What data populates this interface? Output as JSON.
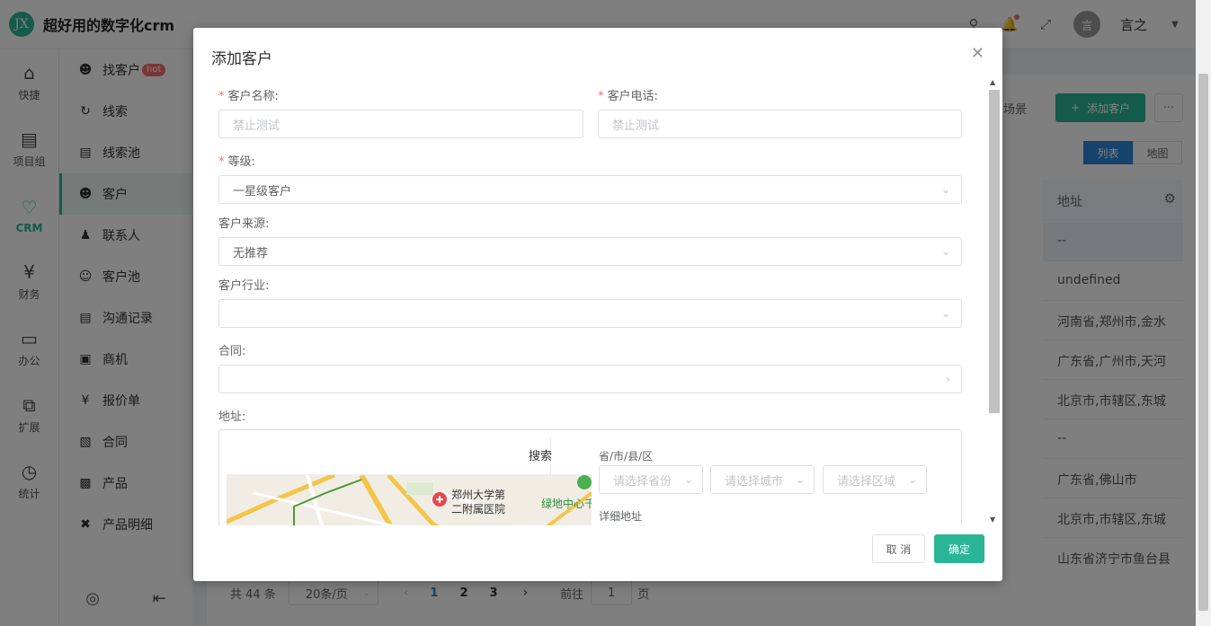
{
  "header": {
    "logo_text": "JX",
    "app_title": "超好用的数字化crm",
    "avatar_char": "言",
    "user_name": "言之"
  },
  "rail": [
    {
      "label": "快捷",
      "icon": "home-icon"
    },
    {
      "label": "项目组",
      "icon": "document-icon"
    },
    {
      "label": "CRM",
      "icon": "crm-heart-icon",
      "active": true
    },
    {
      "label": "财务",
      "icon": "finance-icon"
    },
    {
      "label": "办公",
      "icon": "monitor-icon"
    },
    {
      "label": "扩展",
      "icon": "extend-icon"
    },
    {
      "label": "统计",
      "icon": "chart-icon"
    }
  ],
  "submenu": [
    {
      "label": "找客户",
      "badge": "hot"
    },
    {
      "label": "线索"
    },
    {
      "label": "线索池"
    },
    {
      "label": "客户",
      "active": true
    },
    {
      "label": "联系人"
    },
    {
      "label": "客户池"
    },
    {
      "label": "沟通记录"
    },
    {
      "label": "商机"
    },
    {
      "label": "报价单"
    },
    {
      "label": "合同"
    },
    {
      "label": "产品"
    },
    {
      "label": "产品明细"
    }
  ],
  "toolbar": {
    "scene_label": "场景",
    "add_customer": "添加客户",
    "more": "···",
    "view_list": "列表",
    "view_map": "地图"
  },
  "table": {
    "address_header": "地址",
    "addresses": [
      "--",
      "undefined",
      "河南省,郑州市,金水",
      "广东省,广州市,天河",
      "北京市,市辖区,东城",
      "--",
      "广东省,佛山市",
      "北京市,市辖区,东城",
      "山东省济宁市鱼台县"
    ]
  },
  "pagination": {
    "total": "共 44 条",
    "page_size": "20条/页",
    "pages": [
      "1",
      "2",
      "3"
    ],
    "current": "1",
    "goto_label": "前往",
    "goto_value": "1",
    "goto_unit": "页"
  },
  "dialog": {
    "title": "添加客户",
    "name_label": "客户名称:",
    "name_placeholder": "禁止测试",
    "phone_label": "客户电话:",
    "phone_placeholder": "禁止测试",
    "level_label": "等级:",
    "level_value": "一星级客户",
    "source_label": "客户来源:",
    "source_value": "无推荐",
    "industry_label": "客户行业:",
    "industry_value": "",
    "contract_label": "合同:",
    "contract_value": "",
    "address_label": "地址:",
    "search_button": "搜索",
    "map_poi_1": "郑州大学第",
    "map_poi_2": "二附属医院",
    "map_poi_3": "绿地中心千",
    "region_label": "省/市/县/区",
    "province_placeholder": "请选择省份",
    "city_placeholder": "请选择城市",
    "district_placeholder": "请选择区域",
    "detail_label": "详细地址",
    "cancel": "取 消",
    "confirm": "确定"
  },
  "colors": {
    "accent": "#2bb597",
    "primary": "#2b87d8",
    "danger": "#f56c6c"
  }
}
